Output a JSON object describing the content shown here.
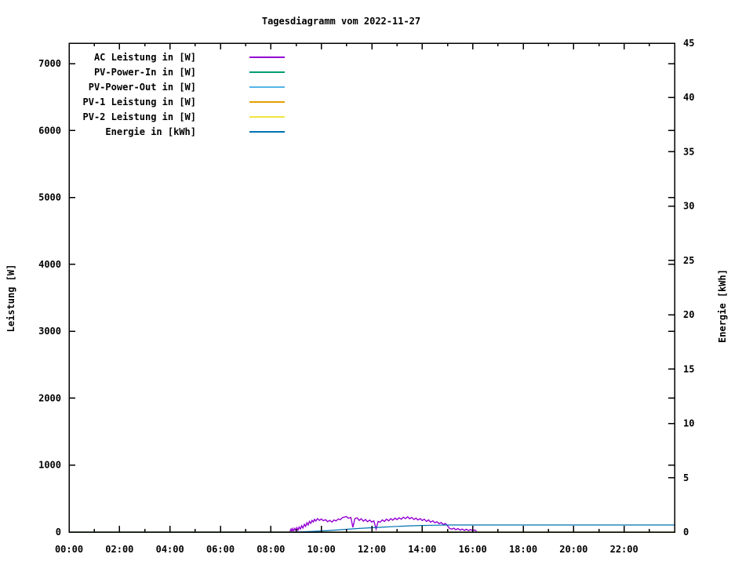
{
  "page": {
    "background": "#ffffff",
    "text_color": "#000000"
  },
  "chart_data": {
    "type": "line",
    "title": "Tagesdiagramm vom 2022-11-27",
    "grid": false,
    "legend_position": "top-left-inside",
    "x_axis": {
      "unit": "time",
      "range_hours": [
        0,
        24
      ],
      "major_tick_step_hours": 2,
      "minor_tick_step_hours": 1,
      "tick_labels": [
        "00:00",
        "02:00",
        "04:00",
        "06:00",
        "08:00",
        "10:00",
        "12:00",
        "14:00",
        "16:00",
        "18:00",
        "20:00",
        "22:00"
      ]
    },
    "y1_axis": {
      "label": "Leistung [W]",
      "range": [
        0,
        7300
      ],
      "ticks": [
        0,
        1000,
        2000,
        3000,
        4000,
        5000,
        6000,
        7000
      ]
    },
    "y2_axis": {
      "label": "Energie [kWh]",
      "range": [
        0,
        45
      ],
      "ticks": [
        0,
        5,
        10,
        15,
        20,
        25,
        30,
        35,
        40,
        45
      ]
    },
    "series": [
      {
        "name": "AC Leistung in [W]",
        "color": "#9400D3",
        "axis": "y1",
        "points": [
          [
            8.75,
            5
          ],
          [
            8.8,
            45
          ],
          [
            8.83,
            12
          ],
          [
            8.87,
            50
          ],
          [
            8.9,
            15
          ],
          [
            8.95,
            55
          ],
          [
            9.0,
            20
          ],
          [
            9.03,
            65
          ],
          [
            9.07,
            28
          ],
          [
            9.12,
            75
          ],
          [
            9.17,
            45
          ],
          [
            9.22,
            95
          ],
          [
            9.27,
            60
          ],
          [
            9.33,
            115
          ],
          [
            9.38,
            85
          ],
          [
            9.43,
            140
          ],
          [
            9.48,
            105
          ],
          [
            9.53,
            160
          ],
          [
            9.58,
            130
          ],
          [
            9.63,
            175
          ],
          [
            9.68,
            150
          ],
          [
            9.73,
            190
          ],
          [
            9.78,
            165
          ],
          [
            9.85,
            200
          ],
          [
            9.92,
            175
          ],
          [
            10.0,
            195
          ],
          [
            10.08,
            170
          ],
          [
            10.17,
            185
          ],
          [
            10.25,
            155
          ],
          [
            10.33,
            175
          ],
          [
            10.42,
            150
          ],
          [
            10.5,
            180
          ],
          [
            10.58,
            165
          ],
          [
            10.67,
            195
          ],
          [
            10.75,
            185
          ],
          [
            10.83,
            215
          ],
          [
            10.92,
            225
          ],
          [
            11.0,
            230
          ],
          [
            11.08,
            205
          ],
          [
            11.17,
            218
          ],
          [
            11.25,
            70
          ],
          [
            11.33,
            200
          ],
          [
            11.42,
            212
          ],
          [
            11.5,
            175
          ],
          [
            11.58,
            198
          ],
          [
            11.67,
            162
          ],
          [
            11.75,
            188
          ],
          [
            11.83,
            155
          ],
          [
            11.92,
            178
          ],
          [
            12.0,
            150
          ],
          [
            12.08,
            168
          ],
          [
            12.17,
            45
          ],
          [
            12.25,
            160
          ],
          [
            12.33,
            148
          ],
          [
            12.42,
            180
          ],
          [
            12.5,
            158
          ],
          [
            12.58,
            192
          ],
          [
            12.67,
            168
          ],
          [
            12.75,
            200
          ],
          [
            12.83,
            178
          ],
          [
            12.92,
            208
          ],
          [
            13.0,
            185
          ],
          [
            13.08,
            212
          ],
          [
            13.17,
            192
          ],
          [
            13.25,
            222
          ],
          [
            13.33,
            200
          ],
          [
            13.42,
            228
          ],
          [
            13.5,
            198
          ],
          [
            13.58,
            218
          ],
          [
            13.67,
            188
          ],
          [
            13.75,
            208
          ],
          [
            13.83,
            180
          ],
          [
            13.92,
            200
          ],
          [
            14.0,
            172
          ],
          [
            14.08,
            192
          ],
          [
            14.17,
            158
          ],
          [
            14.25,
            182
          ],
          [
            14.33,
            148
          ],
          [
            14.42,
            168
          ],
          [
            14.5,
            138
          ],
          [
            14.58,
            155
          ],
          [
            14.67,
            125
          ],
          [
            14.75,
            142
          ],
          [
            14.83,
            112
          ],
          [
            14.92,
            128
          ],
          [
            15.0,
            95
          ],
          [
            15.08,
            55
          ],
          [
            15.17,
            42
          ],
          [
            15.25,
            58
          ],
          [
            15.33,
            35
          ],
          [
            15.42,
            52
          ],
          [
            15.5,
            28
          ],
          [
            15.58,
            45
          ],
          [
            15.67,
            25
          ],
          [
            15.75,
            42
          ],
          [
            15.83,
            22
          ],
          [
            15.92,
            38
          ],
          [
            16.0,
            18
          ],
          [
            16.08,
            32
          ],
          [
            16.17,
            5
          ]
        ]
      },
      {
        "name": "PV-Power-In in [W]",
        "color": "#009E73",
        "axis": "y1",
        "points": [
          [
            0,
            0
          ],
          [
            24,
            0
          ]
        ]
      },
      {
        "name": "PV-Power-Out in [W]",
        "color": "#56B4E9",
        "axis": "y1",
        "points": [
          [
            0,
            0
          ],
          [
            24,
            0
          ]
        ]
      },
      {
        "name": "PV-1 Leistung in [W]",
        "color": "#E69F00",
        "axis": "y1",
        "points": [
          [
            0,
            0
          ],
          [
            24,
            0
          ]
        ]
      },
      {
        "name": "PV-2 Leistung in [W]",
        "color": "#F0E442",
        "axis": "y1",
        "points": [
          [
            0,
            0
          ],
          [
            24,
            0
          ]
        ]
      },
      {
        "name": "Energie in [kWh]",
        "color": "#0072B2",
        "axis": "y2",
        "points": [
          [
            0,
            0
          ],
          [
            8.9,
            0
          ],
          [
            9.5,
            0.04
          ],
          [
            10.0,
            0.1
          ],
          [
            10.5,
            0.17
          ],
          [
            11.0,
            0.25
          ],
          [
            11.5,
            0.33
          ],
          [
            12.0,
            0.4
          ],
          [
            12.5,
            0.46
          ],
          [
            13.0,
            0.52
          ],
          [
            13.5,
            0.57
          ],
          [
            14.0,
            0.61
          ],
          [
            14.5,
            0.63
          ],
          [
            15.0,
            0.65
          ],
          [
            15.5,
            0.65
          ],
          [
            24,
            0.65
          ]
        ]
      }
    ]
  }
}
